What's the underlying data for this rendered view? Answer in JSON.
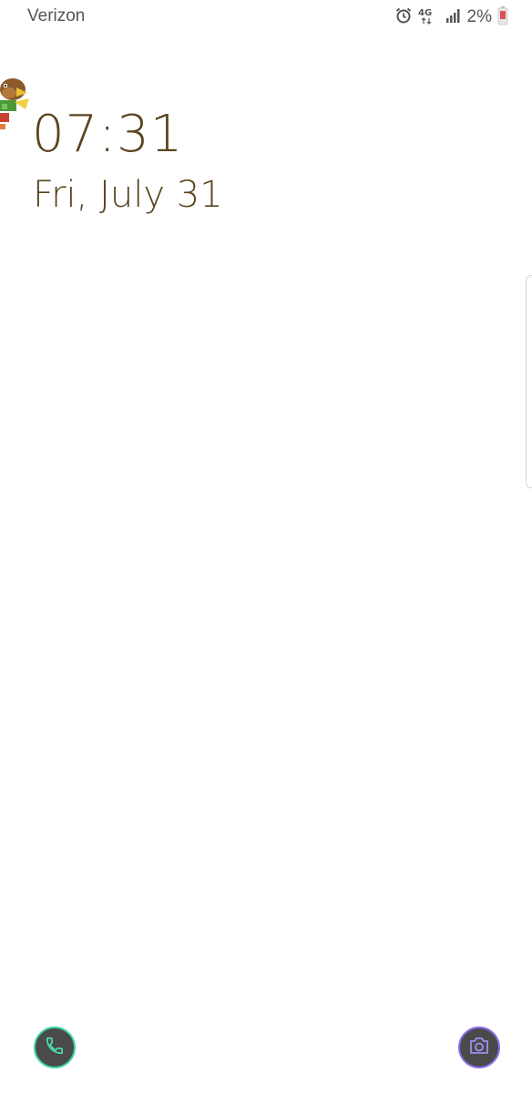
{
  "status_bar": {
    "carrier": "Verizon",
    "network_type": "4G",
    "battery_percent": "2%",
    "icons": [
      "alarm-icon",
      "network-4g-icon",
      "signal-icon",
      "battery-icon"
    ]
  },
  "lockscreen": {
    "time": "07:31",
    "date": "Fri, July 31"
  },
  "shortcuts": {
    "left": "phone-icon",
    "right": "camera-icon"
  },
  "colors": {
    "clock_text": "#5a4520",
    "phone_ring": "#3bd6a0",
    "camera_ring": "#8e6cf0",
    "battery_low": "#e05050"
  }
}
